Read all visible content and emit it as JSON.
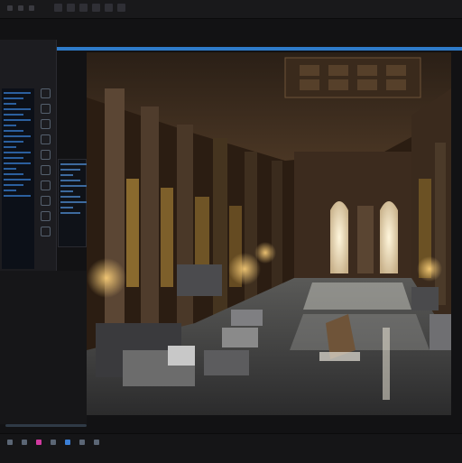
{
  "window": {
    "title": ""
  },
  "left_panel": {
    "title": ""
  },
  "viewport": {
    "content": "render-preview"
  },
  "icons": {
    "menu": [
      "menu-file",
      "menu-edit",
      "menu-view",
      "menu-render",
      "menu-window",
      "menu-help"
    ],
    "tools": [
      "cursor-icon",
      "move-icon",
      "rotate-icon",
      "scale-icon",
      "camera-icon",
      "light-icon",
      "grid-icon",
      "settings-icon",
      "brush-icon",
      "eye-icon"
    ],
    "bottom": [
      "play-icon",
      "stop-icon",
      "record-icon",
      "loop-icon",
      "frame-icon",
      "key-icon",
      "marker-icon"
    ]
  },
  "colors": {
    "accent": "#2e7bc9",
    "panel_bg": "#1c1c20",
    "app_bg": "#121214",
    "highlight": "#d13aa0"
  }
}
